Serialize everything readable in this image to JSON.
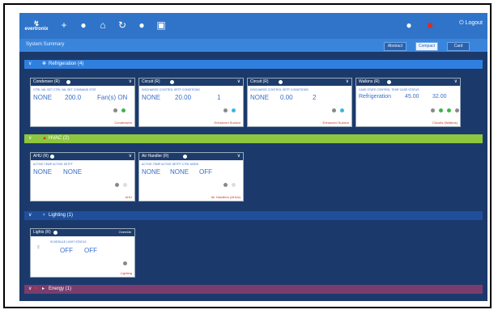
{
  "app": {
    "logo_text": "evertronix"
  },
  "header": {
    "logout_label": "Logout"
  },
  "subheader": {
    "title": "System Summary",
    "views": [
      "Abstract",
      "Compact",
      "Card"
    ]
  },
  "sections": {
    "refrigeration": {
      "label": "Refrigeration (4)",
      "color": "#2f7fde"
    },
    "hvac": {
      "label": "HVAC (2)",
      "color": "#8dc63f"
    },
    "lighting": {
      "label": "Lighting (1)",
      "color": "#1f4f9a"
    },
    "energy": {
      "label": "Energy (1)",
      "color": "#7a3d6e"
    }
  },
  "cards": {
    "c1": {
      "title": "Condenser (R)",
      "labels": "CTRL VAL SET   CTRL VAL SET   COMMAND STAT",
      "values": [
        "NONE",
        "200.0",
        "Fan(s) ON"
      ],
      "footer": "Condensers"
    },
    "c2": {
      "title": "Circuit (R)",
      "labels": "DISCHARGE   CONTROL SETP   CONDITIONS",
      "values": [
        "NONE",
        "20.00",
        "1"
      ],
      "footer": "Enhanced Suction"
    },
    "c3": {
      "title": "Circuit (R)",
      "labels": "DISCHARGE   CONTROL SETP   CONDITIONS",
      "values": [
        "NONE",
        "0.00",
        "2"
      ],
      "footer": "Enhanced Suction"
    },
    "c4": {
      "title": "Walkins (R)",
      "labels": "CASE STATE   CONTROL TEMP   CASE STATUS",
      "values": [
        "Refrigeration",
        "45.00",
        "32.00"
      ],
      "footer": "Circuits (Walkins)"
    },
    "c5": {
      "title": "AHU (R)",
      "labels": "ACTIVE TEMP   ACTIVE SETPT",
      "values": [
        "NONE",
        "NONE"
      ],
      "footer": "AHU"
    },
    "c6": {
      "title": "Air Handler (R)",
      "labels": "ACTIVE TEMP   ACTIVE SETPT   CTRL MODE",
      "values": [
        "NONE",
        "NONE",
        "OFF"
      ],
      "footer": "Air Handlers (AHUs)"
    },
    "c7": {
      "title": "Lights (R)",
      "labels": "SCHEDULE   LIGHT STATUS",
      "values": [
        "OFF",
        "OFF"
      ],
      "footer": "Lighting",
      "tag": "Override"
    }
  }
}
